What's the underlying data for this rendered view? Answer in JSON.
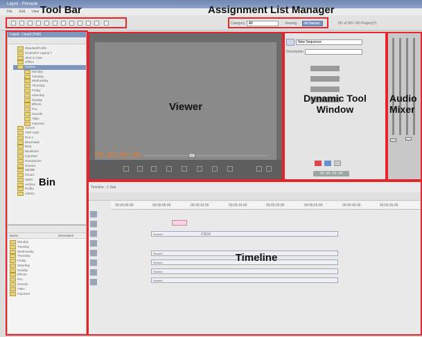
{
  "app": {
    "window_title": "Liquid - Pinnacle",
    "menu": [
      "File",
      "Edit",
      "View"
    ]
  },
  "toolbar": {
    "category_label": "Category",
    "category_value": "All",
    "viewing_label": "Viewing",
    "viewing_value": "All Names",
    "results_text": "0/1 of 0/0 / 0/0 Project(Y)"
  },
  "bin": {
    "header_title": "Liquid - Liquid (Yolk)",
    "tree": [
      "StandardProfile",
      "EmaneEX Laptop T",
      "Shot to Cast",
      "Offline",
      "Archive",
      "Monday",
      "Tuesday",
      "Wednesday",
      "Thursday",
      "Friday",
      "Saturday",
      "Sunday",
      "Effects",
      "PAL",
      "Sounds",
      "Titles",
      "Imported",
      "Jaxson",
      "TMP-CBD",
      "Run 1",
      "Beachside",
      "Beta",
      "Backtrack",
      "Imported",
      "Resolutions",
      "Oceans",
      "Wildlife",
      "iCloud",
      "Sales",
      "Archive",
      "Profile",
      "Library"
    ],
    "columns": [
      "Name",
      "Generation"
    ],
    "list": [
      "Monday",
      "Tuesday",
      "Wednesday",
      "Thursday",
      "Friday",
      "Saturday",
      "Sunday",
      "Effects",
      "PAL",
      "Sounds",
      "Titles",
      "Imported"
    ]
  },
  "viewer": {
    "timecode": "00:00:00:00"
  },
  "tool_window": {
    "title_field": "New Sequence",
    "description_label": "Description",
    "timecode": "00:00:00:00"
  },
  "timeline": {
    "header": "Timeline - 1 Sub",
    "ruler": [
      "00:00:00:00",
      "00:00:05:00",
      "00:00:10:00",
      "00:00:15:00",
      "00:00:20:00",
      "00:00:25:00",
      "00:00:30:00",
      "00:00:35:00"
    ],
    "clips": [
      {
        "label": "Scene4"
      },
      {
        "label": "Scene3"
      },
      {
        "label": "Scene4"
      },
      {
        "label": "Scene4"
      },
      {
        "label": "Scene4"
      },
      {
        "label": "Scene4"
      }
    ],
    "clip_labels_right": "CRDX"
  },
  "callouts": {
    "tool_bar": "Tool Bar",
    "assignment_list_manager": "Assignment List Manager",
    "viewer": "Viewer",
    "dynamic_tool_window": "Dynamic Tool Window",
    "audio_mixer": "Audio Mixer",
    "bin": "Bin",
    "timeline": "Timeline"
  }
}
